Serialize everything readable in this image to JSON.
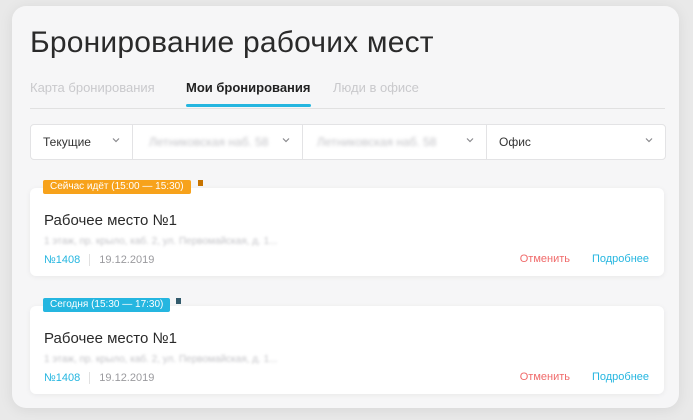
{
  "page": {
    "title": "Бронирование рабочих мест"
  },
  "tabs": [
    {
      "label": "Карта бронирования",
      "active": false
    },
    {
      "label": "Мои бронирования",
      "active": true
    },
    {
      "label": "Люди в офисе",
      "active": false
    }
  ],
  "filters": [
    {
      "value": "Текущие",
      "obscured": false
    },
    {
      "value": "Летниковская наб. 58",
      "obscured": true
    },
    {
      "value": "Летниковская наб. 58",
      "obscured": true
    },
    {
      "value": "Офис",
      "obscured": false
    }
  ],
  "bookings": [
    {
      "badge": "Сейчас идёт (15:00 — 15:30)",
      "badge_color": "#f7a21b",
      "badge_fold_color": "#c77400",
      "title": "Рабочее место №1",
      "address": "1 этаж, пр. крыло, каб. 2, ул. Первомайская, д. 1...",
      "id": "№1408",
      "date": "19.12.2019",
      "cancel_label": "Отменить",
      "details_label": "Подробнее"
    },
    {
      "badge": "Сегодня (15:30 — 17:30)",
      "badge_color": "#25b6e0",
      "badge_fold_color": "#335b6c",
      "title": "Рабочее место №1",
      "address": "1 этаж, пр. крыло, каб. 2, ул. Первомайская, д. 1...",
      "id": "№1408",
      "date": "19.12.2019",
      "cancel_label": "Отменить",
      "details_label": "Подробнее"
    }
  ],
  "colors": {
    "accent": "#25b6e0",
    "danger": "#f06a6a",
    "warning": "#f7a21b"
  },
  "icons": {
    "dropdown": "chevron-down-icon"
  }
}
